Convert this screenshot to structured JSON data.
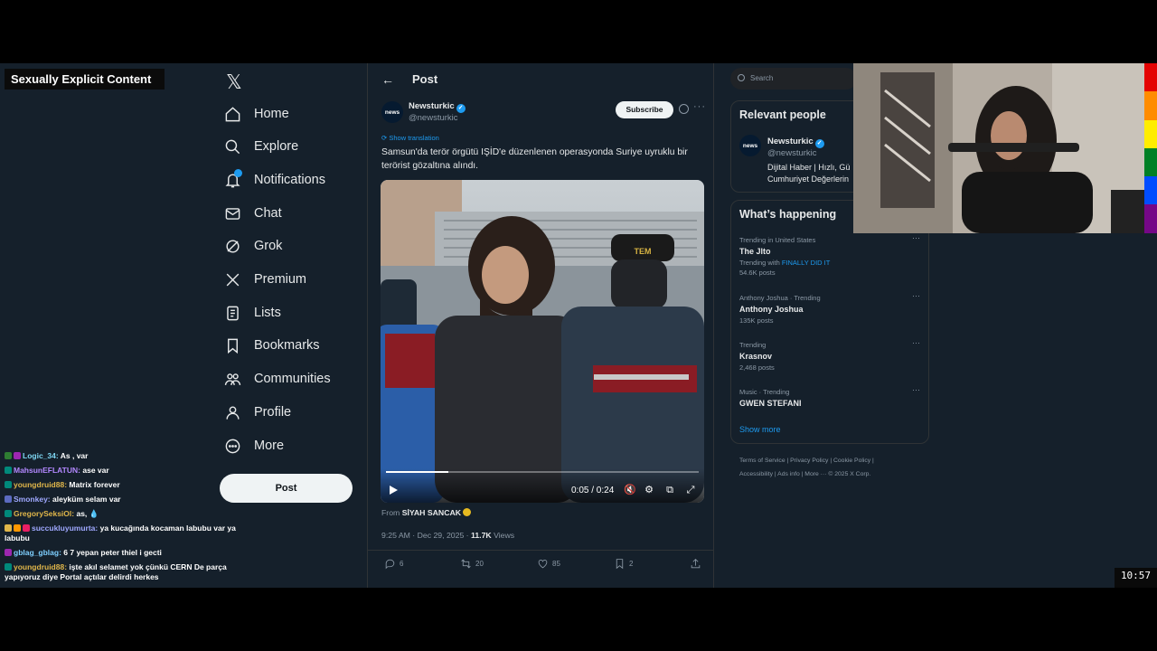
{
  "overlay_title": "Sexually Explicit Content",
  "chat": [
    {
      "user": "Logic_34",
      "user_color": "#7ed6f2",
      "text": "As , var",
      "badges": [
        "#2e7d32",
        "#9c27b0"
      ]
    },
    {
      "user": "MahsunEFLATUN",
      "user_color": "#b388ff",
      "text": "ase var",
      "badges": [
        "#00897b"
      ]
    },
    {
      "user": "youngdruid88",
      "user_color": "#e0b64a",
      "text": "Matrix forever",
      "badges": [
        "#00897b"
      ]
    },
    {
      "user": "Smonkey",
      "user_color": "#9fa8ff",
      "text": "aleyküm selam var",
      "badges": [
        "#5c6bc0"
      ]
    },
    {
      "user": "GregorySeksiOl",
      "user_color": "#e0b64a",
      "text": "as, 💧",
      "badges": [
        "#00897b"
      ]
    },
    {
      "user": "succukluyumurta",
      "user_color": "#9fa8ff",
      "text": "ya kucağında kocaman labubu var ya labubu",
      "badges": [
        "#e0b64a",
        "#ff9800",
        "#e91e63"
      ]
    },
    {
      "user": "gblag_gblag",
      "user_color": "#7ecfff",
      "text": "6 7 yepan peter thiel i gecti",
      "badges": [
        "#9c27b0"
      ]
    },
    {
      "user": "youngdruid88",
      "user_color": "#e0b64a",
      "text": "işte akıl selamet yok çünkü CERN De parça yapıyoruz diye Portal açtılar delirdi herkes",
      "badges": [
        "#00897b"
      ]
    }
  ],
  "nav": {
    "logo": "𝕏",
    "items": [
      "Home",
      "Explore",
      "Notifications",
      "Chat",
      "Grok",
      "Premium",
      "Lists",
      "Bookmarks",
      "Communities",
      "Profile",
      "More"
    ],
    "post_button": "Post"
  },
  "post": {
    "header": "Post",
    "back": "←",
    "author": {
      "name": "Newsturkic",
      "handle": "@newsturkic",
      "avatar_text": "news"
    },
    "subscribe": "Subscribe",
    "show_translation": "Show translation",
    "text": "Samsun'da terör örgütü IŞİD'e düzenlenen operasyonda Suriye uyruklu bir terörist gözaltına alındı.",
    "video": {
      "time": "0:05 / 0:24",
      "progress": 0.2
    },
    "from_label": "From",
    "from_name": "SİYAH SANCAK",
    "meta_time": "9:25 AM · Dec 29, 2025 · ",
    "views": "11.7K",
    "views_label": " Views",
    "actions": {
      "replies": "6",
      "reposts": "20",
      "likes": "85",
      "bookmarks": "2"
    }
  },
  "sidebar": {
    "search_placeholder": "Search",
    "relevant_title": "Relevant people",
    "relevant": {
      "name": "Newsturkic",
      "handle": "@newsturkic",
      "avatar_text": "news",
      "bio_line1": "Dijital Haber | Hızlı, Gü",
      "bio_line2": "Cumhuriyet Değerlerin"
    },
    "happening_title": "What’s happening",
    "trends": [
      {
        "category": "Trending in United States",
        "name": "The Jlto",
        "posts_prefix": "Trending with ",
        "posts_link": "FINALLY DID IT",
        "posts": "54.6K posts"
      },
      {
        "category": "Anthony Joshua · Trending",
        "name": "Anthony Joshua",
        "posts": "135K posts"
      },
      {
        "category": "Trending",
        "name": "Krasnov",
        "posts": "2,468 posts"
      },
      {
        "category": "Music · Trending",
        "name": "GWEN STEFANI",
        "posts": ""
      }
    ],
    "show_more": "Show more",
    "footer_line1": "Terms of Service  |  Privacy Policy  |  Cookie Policy  |",
    "footer_line2": "Accessibility  |  Ads info  |  More ···  © 2025 X Corp."
  },
  "clock": "10:57",
  "colors": {
    "accent": "#1d9bf0",
    "background": "#15202b",
    "border": "#2f3336"
  }
}
